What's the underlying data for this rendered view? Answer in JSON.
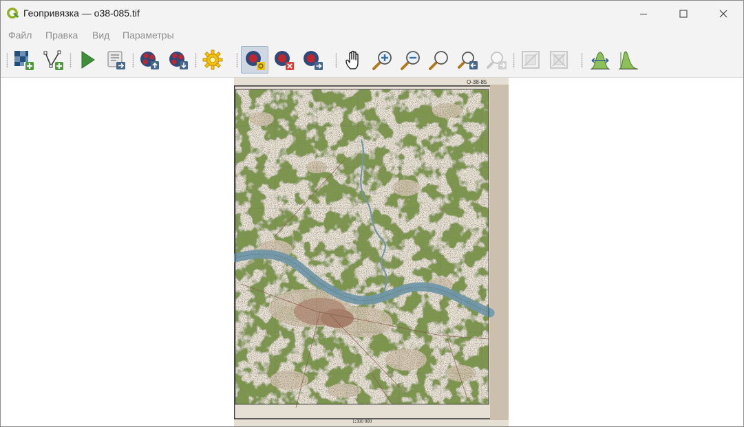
{
  "window": {
    "title": "Геопривязка — o38-085.tif",
    "app_icon": "qgis-logo-icon",
    "controls": [
      "minimize-icon",
      "maximize-icon",
      "close-icon"
    ]
  },
  "menu": {
    "items": [
      "Файл",
      "Правка",
      "Вид",
      "Параметры"
    ]
  },
  "toolbar": {
    "buttons": [
      {
        "name": "open-raster-icon",
        "active": false
      },
      {
        "name": "add-vector-point-icon",
        "active": false
      },
      {
        "name": "run-georeferencing-icon",
        "active": false
      },
      {
        "name": "generate-script-icon",
        "active": false
      },
      {
        "name": "load-gcp-points-icon",
        "active": false
      },
      {
        "name": "save-gcp-points-icon",
        "active": false
      },
      {
        "name": "transformation-settings-icon",
        "active": false
      },
      {
        "name": "add-point-icon",
        "active": true
      },
      {
        "name": "delete-point-icon",
        "active": false
      },
      {
        "name": "move-point-icon",
        "active": false
      },
      {
        "name": "pan-hand-icon",
        "active": false
      },
      {
        "name": "zoom-in-icon",
        "active": false
      },
      {
        "name": "zoom-out-icon",
        "active": false
      },
      {
        "name": "zoom-to-layer-icon",
        "active": false
      },
      {
        "name": "zoom-last-icon",
        "active": false
      },
      {
        "name": "zoom-next-icon",
        "active": false
      },
      {
        "name": "link-georef-to-qgis-icon",
        "active": false
      },
      {
        "name": "link-qgis-to-georef-icon",
        "active": false
      },
      {
        "name": "full-histogram-stretch-icon",
        "active": false
      },
      {
        "name": "local-histogram-stretch-icon",
        "active": false
      }
    ]
  },
  "canvas": {
    "map_labels": {
      "sheet_top_right": "O-38-85",
      "scale_bottom": "1:300 000"
    },
    "colors": {
      "forest": "#7d9a4a",
      "open_land": "#d8c9b3",
      "river": "#6f9cb3",
      "frame": "#3b3b3b",
      "margin": "#e6dfd4"
    }
  }
}
